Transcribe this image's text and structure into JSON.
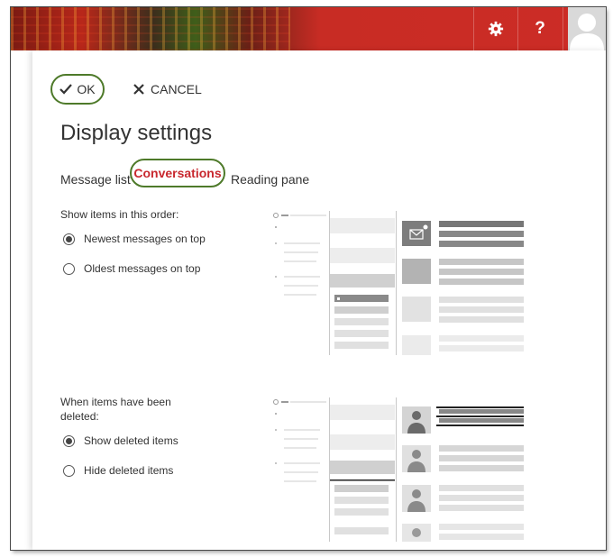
{
  "header": {
    "settings_icon": "gear-icon",
    "help_label": "?",
    "avatar_icon": "user-silhouette-icon"
  },
  "toolbar": {
    "ok_label": "OK",
    "cancel_label": "CANCEL"
  },
  "page_title": "Display settings",
  "tabs": [
    {
      "label": "Message list",
      "selected": false
    },
    {
      "label": "Conversations",
      "selected": true
    },
    {
      "label": "Reading pane",
      "selected": false
    }
  ],
  "order_section": {
    "label": "Show items in this order:",
    "options": [
      {
        "label": "Newest messages on top",
        "selected": true
      },
      {
        "label": "Oldest messages on top",
        "selected": false
      }
    ]
  },
  "deleted_section": {
    "label": "When items have been deleted:",
    "options": [
      {
        "label": "Show deleted items",
        "selected": true
      },
      {
        "label": "Hide deleted items",
        "selected": false
      }
    ]
  },
  "colors": {
    "accent_red": "#c8282e",
    "highlight_green": "#4e7a2a",
    "header_red": "#cc2c26"
  }
}
